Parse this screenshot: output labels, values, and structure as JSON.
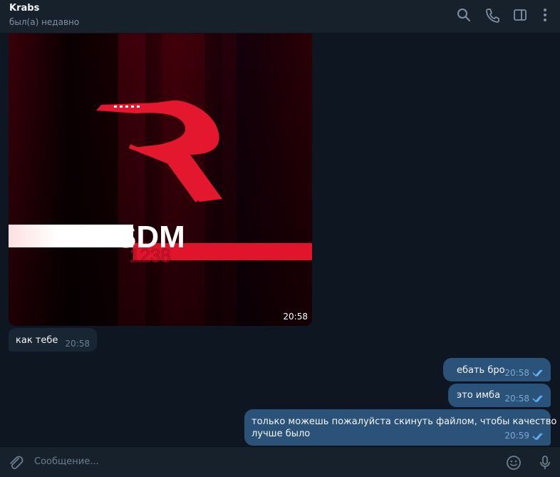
{
  "header": {
    "name": "Krabs",
    "status": "был(а) недавно",
    "icons": [
      "search-icon",
      "phone-icon",
      "sidebar-toggle-icon",
      "more-icon"
    ]
  },
  "photo": {
    "brand_text": "SDM",
    "brand_sub": "1238",
    "time": "20:58"
  },
  "messages": [
    {
      "direction": "in",
      "text": "как тебе",
      "time": "20:58"
    },
    {
      "direction": "out",
      "text": "ебать бро",
      "time": "20:58",
      "read": true
    },
    {
      "direction": "out",
      "text": "это имба",
      "time": "20:58",
      "read": true
    },
    {
      "direction": "out",
      "text_line1": "только можешь пожалуйста скинуть файлом, чтобы качество",
      "text_line2": "лучше было",
      "time": "20:59",
      "read": true
    }
  ],
  "composer": {
    "placeholder": "Сообщение...",
    "icons": [
      "attach-icon",
      "emoji-icon",
      "microphone-icon"
    ]
  },
  "colors": {
    "background": "#0e1621",
    "header": "#17212b",
    "incoming_bubble": "#182533",
    "outgoing_bubble": "#2b5278",
    "accent": "#5eb5f7"
  }
}
